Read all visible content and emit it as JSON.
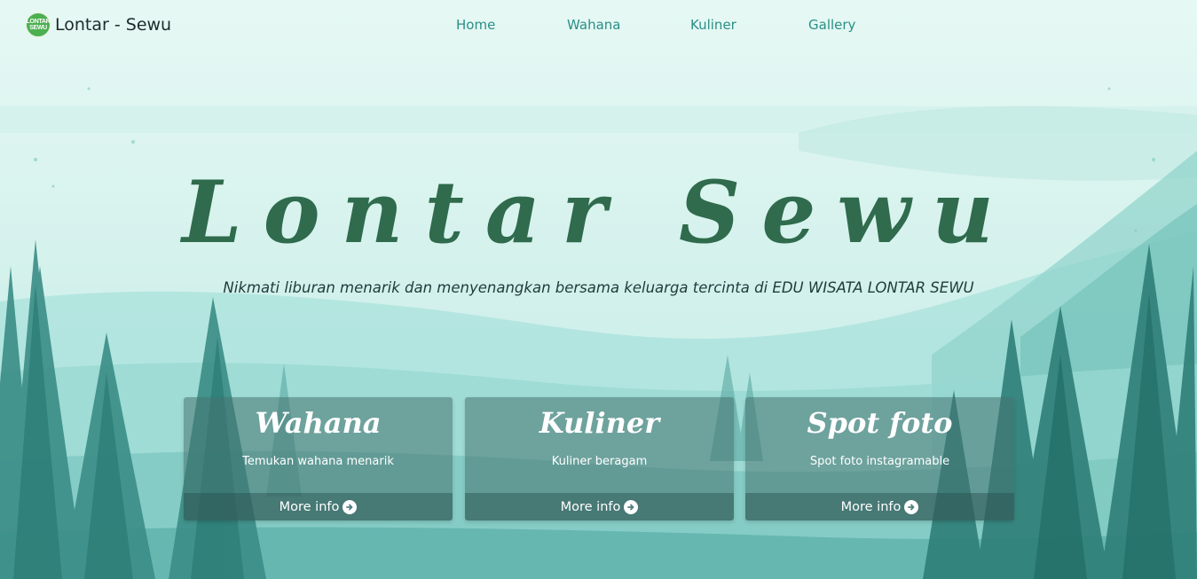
{
  "brand": {
    "logo_text": "LONTAR SEWU",
    "name": "Lontar - Sewu"
  },
  "nav": {
    "items": [
      {
        "label": "Home"
      },
      {
        "label": "Wahana"
      },
      {
        "label": "Kuliner"
      },
      {
        "label": "Gallery"
      }
    ]
  },
  "hero": {
    "title": "Lontar Sewu",
    "subtitle": "Nikmati liburan menarik dan menyenangkan bersama keluarga tercinta di EDU WISATA LONTAR SEWU"
  },
  "cards": [
    {
      "title": "Wahana",
      "description": "Temukan wahana menarik",
      "link": "More info"
    },
    {
      "title": "Kuliner",
      "description": "Kuliner beragam",
      "link": "More info"
    },
    {
      "title": "Spot foto",
      "description": "Spot foto instagramable",
      "link": "More info"
    }
  ],
  "colors": {
    "nav_link": "#2b8f86",
    "title": "#2f6b4c",
    "forest": "#2e7f78"
  },
  "icons": {
    "brand": "lontar-sewu-logo",
    "more_info": "arrow-circle-right-icon"
  }
}
